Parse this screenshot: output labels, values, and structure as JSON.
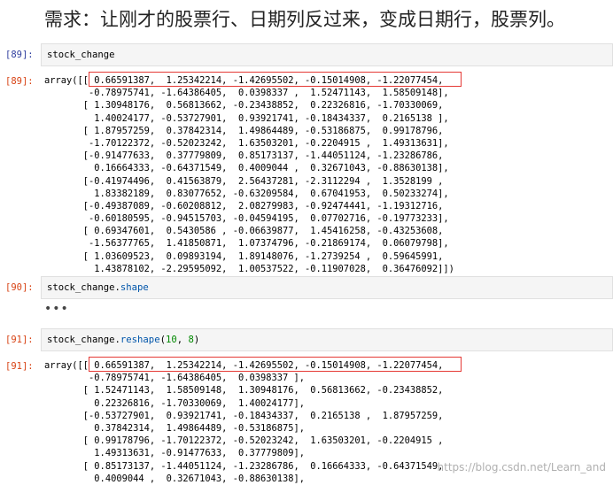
{
  "heading": "需求：让刚才的股票行、日期列反过来，变成日期行，股票列。",
  "cells": [
    {
      "in_prompt": "[89]:",
      "input_code": "stock_change",
      "out_prompt": "[89]:",
      "output_lines": [
        "array([[ 0.66591387,  1.25342214, -1.42695502, -0.15014908, -1.22077454,",
        "        -0.78975741, -1.64386405,  0.0398337 ,  1.52471143,  1.58509148],",
        "       [ 1.30948176,  0.56813662, -0.23438852,  0.22326816, -1.70330069,",
        "         1.40024177, -0.53727901,  0.93921741, -0.18434337,  0.2165138 ],",
        "       [ 1.87957259,  0.37842314,  1.49864489, -0.53186875,  0.99178796,",
        "        -1.70122372, -0.52023242,  1.63503201, -0.2204915 ,  1.49313631],",
        "       [-0.91477633,  0.37779809,  0.85173137, -1.44051124, -1.23286786,",
        "         0.16664333, -0.64371549,  0.4009044 ,  0.32671043, -0.88630138],",
        "       [-0.41974496,  0.41563879,  2.56437281, -2.3112294 ,  1.3528199 ,",
        "         1.83382189,  0.83077652, -0.63209584,  0.67041953,  0.50233274],",
        "       [-0.49387089, -0.60208812,  2.08279983, -0.92474441, -1.19312716,",
        "        -0.60180595, -0.94515703, -0.04594195,  0.07702716, -0.19773233],",
        "       [ 0.69347601,  0.5430586 , -0.06639877,  1.45416258, -0.43253608,",
        "        -1.56377765,  1.41850871,  1.07374796, -0.21869174,  0.06079798],",
        "       [ 1.03609523,  0.09893194,  1.89148076, -1.2739254 ,  0.59645991,",
        "         1.43878102, -2.29595092,  1.00537522, -0.11907028,  0.36476092]])"
      ]
    },
    {
      "in_prompt": "[90]:",
      "input_code_obj": "stock_change.",
      "input_code_attr": "shape",
      "ellipsis": "•••"
    },
    {
      "in_prompt": "[91]:",
      "input_code_obj": "stock_change.",
      "input_code_attr": "reshape",
      "input_code_open": "(",
      "input_code_arg1": "10",
      "input_code_sep": ", ",
      "input_code_arg2": "8",
      "input_code_close": ")",
      "out_prompt": "[91]:",
      "output_lines": [
        "array([[ 0.66591387,  1.25342214, -1.42695502, -0.15014908, -1.22077454,",
        "        -0.78975741, -1.64386405,  0.0398337 ],",
        "       [ 1.52471143,  1.58509148,  1.30948176,  0.56813662, -0.23438852,",
        "         0.22326816, -1.70330069,  1.40024177],",
        "       [-0.53727901,  0.93921741, -0.18434337,  0.2165138 ,  1.87957259,",
        "         0.37842314,  1.49864489, -0.53186875],",
        "       [ 0.99178796, -1.70122372, -0.52023242,  1.63503201, -0.2204915 ,",
        "         1.49313631, -0.91477633,  0.37779809],",
        "       [ 0.85173137, -1.44051124, -1.23286786,  0.16664333, -0.64371549,",
        "         0.4009044 ,  0.32671043, -0.88630138],"
      ]
    }
  ],
  "watermark": "https://blog.csdn.net/Learn_and",
  "colors": {
    "in_prompt": "#303f9f",
    "out_prompt": "#d84315",
    "highlight_border": "#e53935"
  }
}
